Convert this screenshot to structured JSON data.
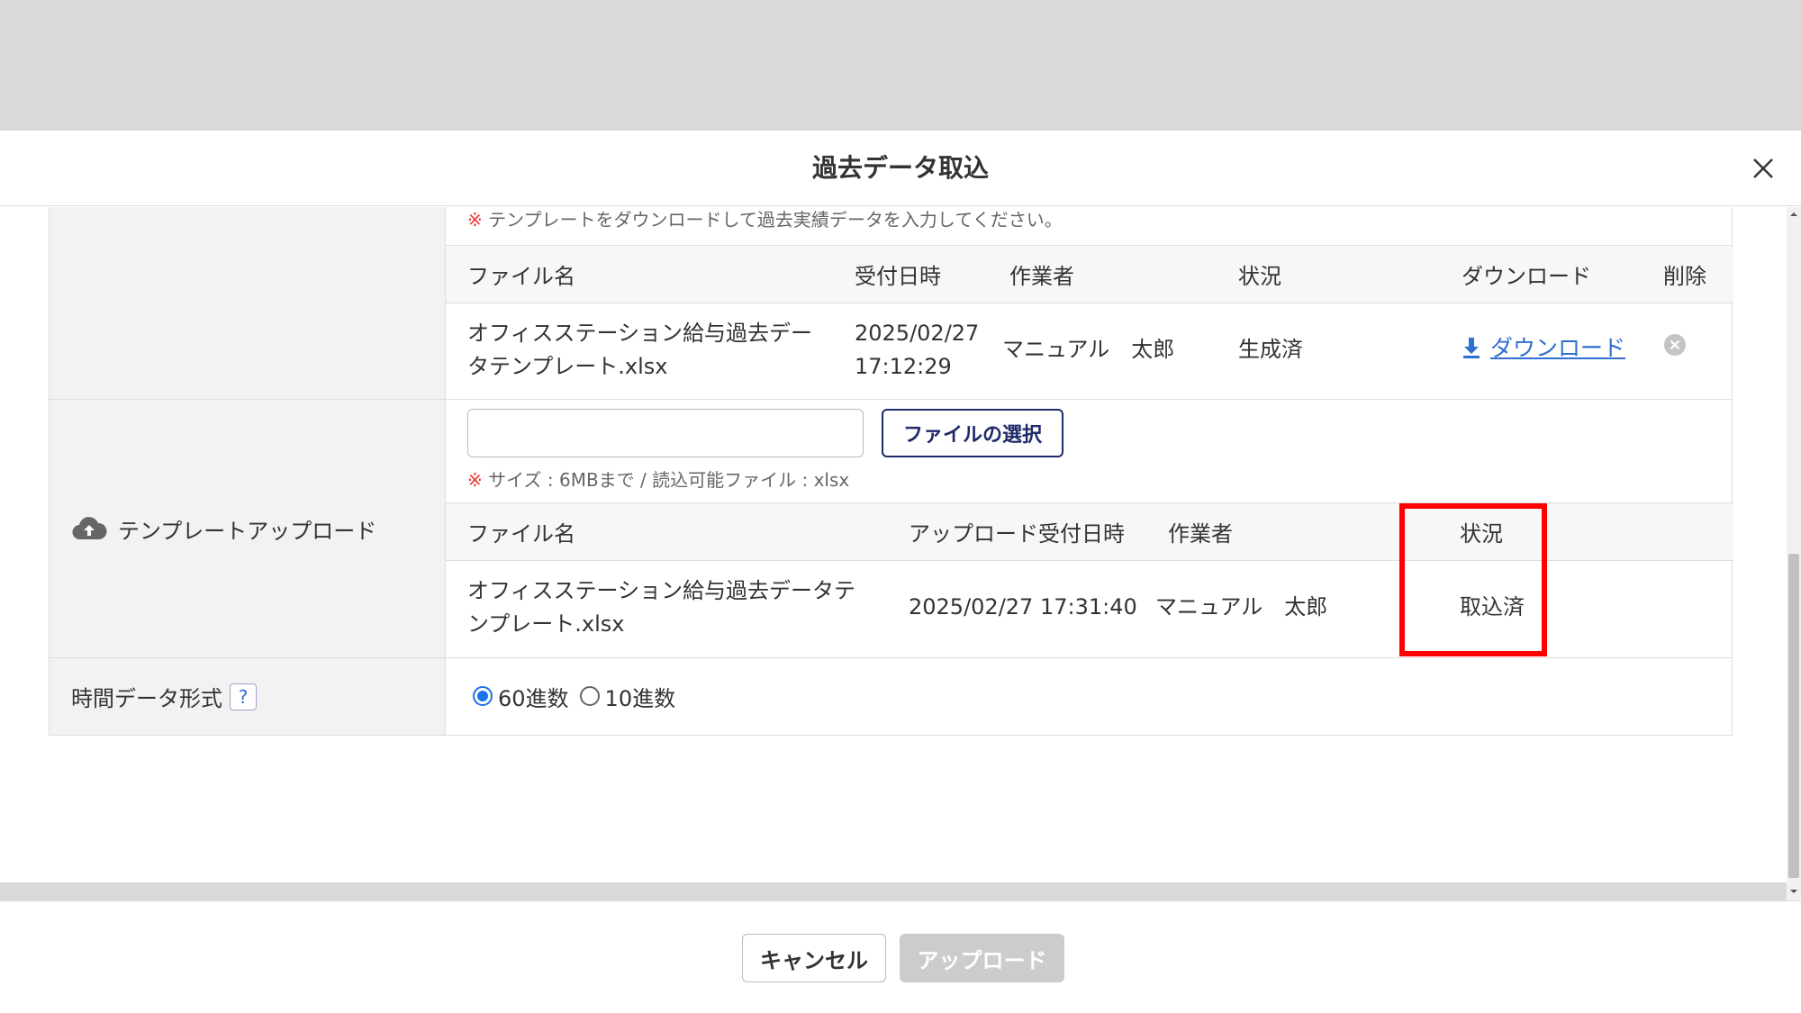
{
  "modal": {
    "title": "過去データ取込"
  },
  "download_section": {
    "note_mark": "※",
    "note_text": "テンプレートをダウンロードして過去実績データを入力してください。",
    "columns": [
      "ファイル名",
      "受付日時",
      "作業者",
      "状況",
      "ダウンロード",
      "削除"
    ],
    "row": {
      "file_name_line1": "オフィスステーション給与過去デー",
      "file_name_line2": "タテンプレート.xlsx",
      "date_line1": "2025/02/27",
      "date_line2": "17:12:29",
      "operator": "マニュアル　太郎",
      "status": "生成済",
      "download_label": "ダウンロード"
    }
  },
  "upload_section": {
    "label": "テンプレートアップロード",
    "file_input_value": "",
    "select_button": "ファイルの選択",
    "note_mark": "※",
    "note_text": "サイズ : 6MBまで / 読込可能ファイル : xlsx",
    "columns": [
      "ファイル名",
      "アップロード受付日時",
      "作業者",
      "状況"
    ],
    "row": {
      "file_name_line1": "オフィスステーション給与過去データテ",
      "file_name_line2": "ンプレート.xlsx",
      "date": "2025/02/27 17:31:40",
      "operator": "マニュアル　太郎",
      "status": "取込済"
    }
  },
  "time_format": {
    "label": "時間データ形式",
    "help": "?",
    "options": [
      "60進数",
      "10進数"
    ],
    "selected": "60進数"
  },
  "footer": {
    "cancel": "キャンセル",
    "upload": "アップロード"
  },
  "colors": {
    "highlight": "#ff0000",
    "link": "#2f6fd0",
    "primary_dark": "#1f2a6b",
    "disabled": "#cccccc"
  }
}
